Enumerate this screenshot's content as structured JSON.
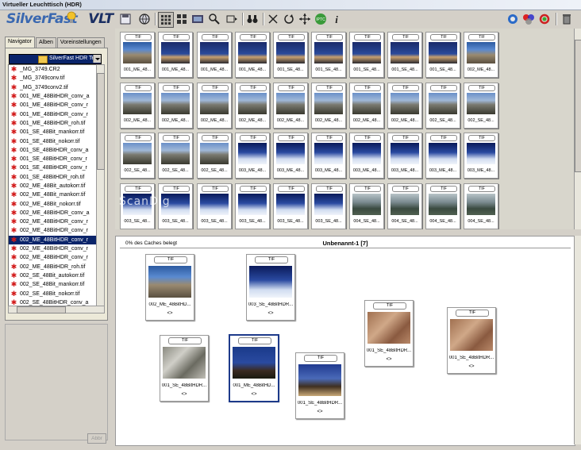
{
  "window": {
    "title": "Virtueller Leuchttisch (HDR)"
  },
  "logo": {
    "text": "SilverFast",
    "suffix": "VLT"
  },
  "toolbar": {
    "icons": [
      "save-icon",
      "globe-icon",
      "grid-view-icon",
      "grid-large-icon",
      "filmstrip-icon",
      "magnifier-icon",
      "thumb-size-icon",
      "binoculars-icon",
      "delete-icon",
      "rotate-icon",
      "move-icon",
      "iptc-icon",
      "info-icon",
      "color-wheel-icon",
      "color-mgmt-icon",
      "color-balance-icon",
      "trash-icon"
    ],
    "iptc_label": "IPTC",
    "info_label": "i"
  },
  "navigator": {
    "tabs": [
      "Navigator",
      "Alben",
      "Voreinstellungen"
    ],
    "folder": "SilverFast HDR Test",
    "files": [
      "_MG_3749.CR2",
      "_MG_3749conv.tif",
      "_MG_3749conv2.tif",
      "001_ME_48BitHDR_conv_a",
      "001_ME_48BitHDR_conv_r",
      "001_ME_48BitHDR_conv_r",
      "001_ME_48BitHDR_roh.tif",
      "001_SE_48Bit_mankorr.tif",
      "001_SE_48Bit_nokorr.tif",
      "001_SE_48BitHDR_conv_a",
      "001_SE_48BitHDR_conv_r",
      "001_SE_48BitHDR_conv_r",
      "001_SE_48BitHDR_roh.tif",
      "002_ME_48Bit_autokorr.tif",
      "002_ME_48Bit_mankorr.tif",
      "002_ME_48Bit_nokorr.tif",
      "002_ME_48BitHDR_conv_a",
      "002_ME_48BitHDR_conv_r",
      "002_ME_48BitHDR_conv_r",
      "002_ME_48BitHDR_conv_r",
      "002_ME_48BitHDR_conv_r",
      "002_ME_48BitHDR_conv_r",
      "002_ME_48BitHDR_roh.tif",
      "002_SE_48Bit_autokorr.tif",
      "002_SE_48Bit_mankorr.tif",
      "002_SE_48Bit_nokorr.tif",
      "002_SE_48BitHDR_conv_a"
    ],
    "selected_index": 19,
    "apply_label": "Abbr"
  },
  "thumbnails": {
    "format": "TIF",
    "rows": [
      [
        "001_ME_48...",
        "001_ME_48...",
        "001_ME_48...",
        "001_ME_48...",
        "001_SE_48...",
        "001_SE_48...",
        "001_SE_48...",
        "001_SE_48...",
        "001_SE_48...",
        "002_ME_48..."
      ],
      [
        "002_ME_48...",
        "002_ME_48...",
        "002_ME_48...",
        "002_ME_48...",
        "002_ME_48...",
        "002_ME_48...",
        "002_ME_48...",
        "002_ME_48...",
        "002_SE_48...",
        "002_SE_48..."
      ],
      [
        "002_SE_48...",
        "002_SE_48...",
        "002_SE_48...",
        "003_ME_48...",
        "003_ME_48...",
        "003_ME_48...",
        "003_ME_48...",
        "003_ME_48...",
        "003_ME_48...",
        "003_ME_48..."
      ],
      [
        "003_SE_48...",
        "003_SE_48...",
        "003_SE_48...",
        "003_SE_48...",
        "003_SE_48...",
        "003_SE_48...",
        "004_SE_48...",
        "004_SE_48...",
        "004_SE_48...",
        "004_SE_48..."
      ]
    ],
    "row_styles": [
      [
        "im-a",
        "im-b",
        "im-b",
        "im-b",
        "im-b",
        "im-b",
        "im-b",
        "im-b",
        "im-b",
        "im-a"
      ],
      [
        "im-c",
        "im-c",
        "im-c",
        "im-c",
        "im-c",
        "im-c",
        "im-c",
        "im-c",
        "im-c",
        "im-c"
      ],
      [
        "im-c",
        "im-c",
        "im-c",
        "im-d",
        "im-d",
        "im-d",
        "im-d",
        "im-d",
        "im-d",
        "im-d"
      ],
      [
        "im-d",
        "im-d",
        "im-d",
        "im-d",
        "im-d",
        "im-d",
        "im-e",
        "im-e",
        "im-e",
        "im-e"
      ]
    ]
  },
  "watermark": "ScanDig",
  "lighttable": {
    "cache_status": "0% des Caches belegt",
    "title": "Unbenannt-1 [7]",
    "rotate_symbol": "<>",
    "cards": [
      {
        "label": "002_ME_48BitHD...",
        "format": "TIF",
        "style": "im-a",
        "selected": false
      },
      {
        "label": "003_SE_48BitHDR...",
        "format": "TIF",
        "style": "im-d",
        "selected": false
      },
      {
        "label": "001_SE_48BitHDR...",
        "format": "TIF",
        "style": "im-f",
        "selected": false
      },
      {
        "label": "001_SE_48BitHDR...",
        "format": "TIF",
        "style": "im-f",
        "selected": false
      },
      {
        "label": "001_SE_48BitHDR...",
        "format": "TIF",
        "style": "im-g",
        "selected": false
      },
      {
        "label": "001_ME_48BitHD...",
        "format": "TIF",
        "style": "im-h",
        "selected": true
      },
      {
        "label": "001_SE_48BitHDR...",
        "format": "TIF",
        "style": "im-i",
        "selected": false
      }
    ]
  }
}
